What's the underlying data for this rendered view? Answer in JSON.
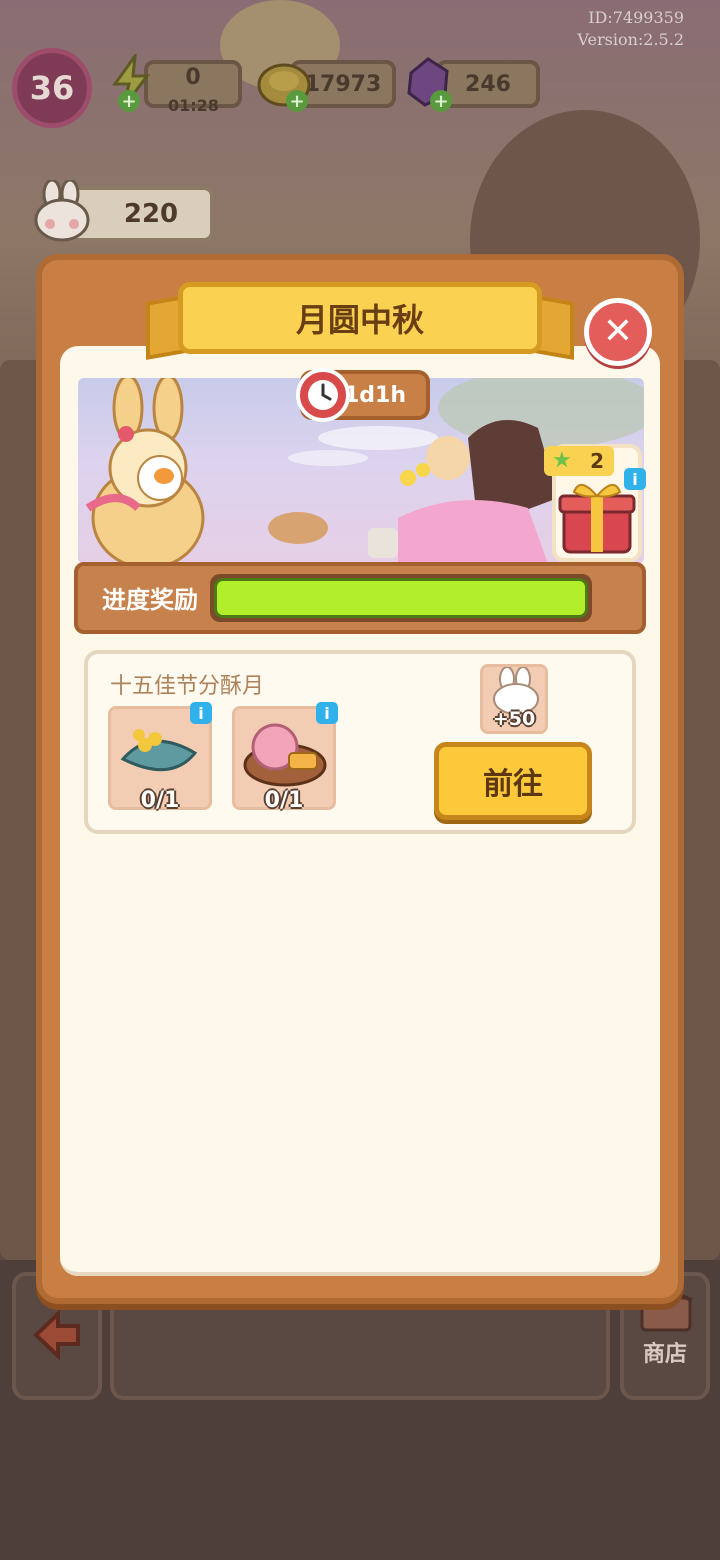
{
  "meta": {
    "player_id": "ID:7499359",
    "version": "Version:2.5.2"
  },
  "hud": {
    "level": "36",
    "energy": {
      "value": "0",
      "timer": "01:28"
    },
    "coins": "17973",
    "gems": "246",
    "bunny_points": "220"
  },
  "modal": {
    "title": "月圆中秋",
    "timer": "1d1h",
    "gift": {
      "star_count": "2"
    },
    "progress": {
      "label": "进度奖励",
      "fraction": 1.0
    },
    "task": {
      "title": "十五佳节分酥月",
      "items": [
        {
          "icon": "osmanthus-leaf-icon",
          "count": "0/1"
        },
        {
          "icon": "mooncake-icon",
          "count": "0/1"
        }
      ],
      "reward": {
        "icon": "bunny-token-icon",
        "amount": "+50"
      },
      "go_label": "前往"
    }
  },
  "bottom": {
    "shop_label": "商店"
  },
  "colors": {
    "accent": "#fbd152",
    "modal": "#c97e44",
    "progress": "#b3ee2a",
    "close": "#e35d5a"
  }
}
